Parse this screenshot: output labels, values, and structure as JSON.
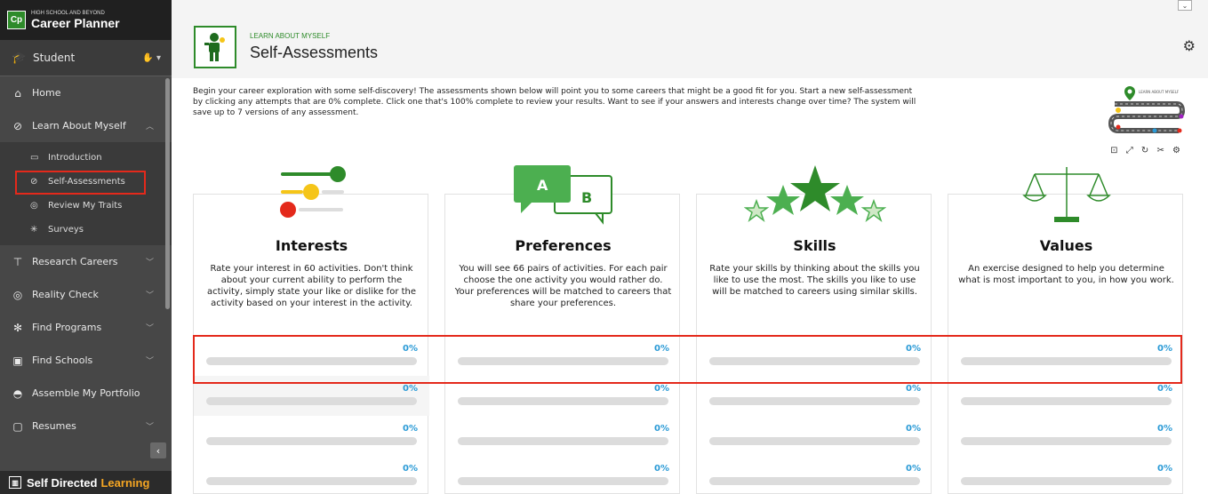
{
  "brand": {
    "logo": "Cp",
    "subtitle": "HIGH SCHOOL AND BEYOND",
    "title": "Career Planner"
  },
  "role": {
    "label": "Student"
  },
  "nav": {
    "home": "Home",
    "learn": "Learn About Myself",
    "sub": [
      "Introduction",
      "Self-Assessments",
      "Review My Traits",
      "Surveys"
    ],
    "research": "Research Careers",
    "reality": "Reality Check",
    "programs": "Find Programs",
    "schools": "Find Schools",
    "portfolio": "Assemble My Portfolio",
    "resumes": "Resumes"
  },
  "footer": {
    "brand": "Self Directed",
    "accent": "Learning"
  },
  "header": {
    "kicker": "LEARN ABOUT MYSELF",
    "title": "Self-Assessments"
  },
  "intro": "Begin your career exploration with some self-discovery! The assessments shown below will point you to some careers that might be a good fit for you. Start a new self-assessment by clicking any attempts that are 0% complete. Click one that's 100% complete to review your results. Want to see if your answers and interests change over time? The system will save up to 7 versions of any assessment.",
  "minimap": {
    "label": "LEARN ABOUT MYSELF"
  },
  "cards": [
    {
      "title": "Interests",
      "desc": "Rate your interest in 60 activities. Don't think about your current ability to perform the activity, simply state your like or dislike for the activity based on your interest in the activity.",
      "attempts": [
        0,
        0,
        0,
        0
      ]
    },
    {
      "title": "Preferences",
      "desc": "You will see 66 pairs of activities. For each pair choose the one activity you would rather do. Your preferences will be matched to careers that share your preferences.",
      "attempts": [
        0,
        0,
        0,
        0
      ],
      "art_a": "A",
      "art_b": "B"
    },
    {
      "title": "Skills",
      "desc": "Rate your skills by thinking about the skills you like to use the most. The skills you like to use will be matched to careers using similar skills.",
      "attempts": [
        0,
        0,
        0,
        0
      ]
    },
    {
      "title": "Values",
      "desc": "An exercise designed to help you determine what is most important to you, in how you work.",
      "attempts": [
        0,
        0,
        0,
        0
      ]
    }
  ],
  "colors": {
    "accent": "#2e8b2a",
    "progress": "#2a9ad6",
    "highlight": "#e4291b"
  }
}
